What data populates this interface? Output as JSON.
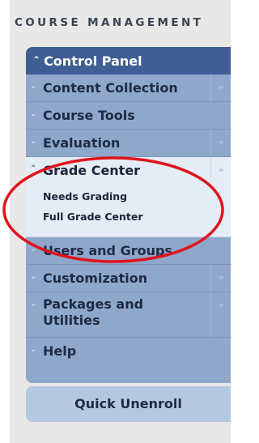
{
  "section_title": "COURSE MANAGEMENT",
  "control_panel": {
    "label": "Control Panel",
    "expand_icon": "chevron-up"
  },
  "menu": {
    "items": [
      {
        "label": "Content Collection",
        "has_submenu": true,
        "state": "collapsed"
      },
      {
        "label": "Course Tools",
        "has_submenu": false,
        "state": "collapsed"
      },
      {
        "label": "Evaluation",
        "has_submenu": true,
        "state": "collapsed"
      },
      {
        "label": "Grade Center",
        "has_submenu": true,
        "state": "expanded",
        "subitems": [
          {
            "label": "Needs Grading"
          },
          {
            "label": "Full Grade Center"
          }
        ]
      },
      {
        "label": "Users and Groups",
        "has_submenu": false,
        "state": "collapsed"
      },
      {
        "label": "Customization",
        "has_submenu": true,
        "state": "collapsed"
      },
      {
        "label": "Packages and Utilities",
        "has_submenu": true,
        "state": "collapsed"
      },
      {
        "label": "Help",
        "has_submenu": false,
        "state": "collapsed"
      }
    ]
  },
  "quick_unenroll": {
    "label": "Quick Unenroll"
  },
  "colors": {
    "header_bg": "#3f5e93",
    "item_bg": "#8fa7cb",
    "active_bg": "#e4ecf6",
    "annotation_circle": "#e0141c"
  }
}
